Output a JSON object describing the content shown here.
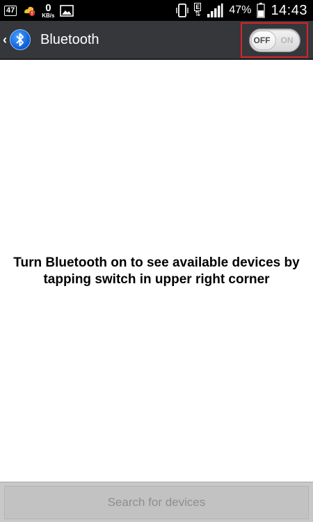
{
  "status_bar": {
    "badge": "47",
    "speed_value": "0",
    "speed_unit": "KB/s",
    "network_type": "E",
    "network_arrows": "⇅",
    "battery_percent": "47%",
    "time": "14:43",
    "icons": [
      "notification-badge-icon",
      "weather-alert-icon",
      "image-icon",
      "vibrate-icon",
      "network-type-icon",
      "signal-icon",
      "battery-icon"
    ]
  },
  "action_bar": {
    "back_glyph": "‹",
    "title": "Bluetooth",
    "toggle": {
      "off_label": "OFF",
      "on_label": "ON",
      "state": "off"
    },
    "highlight_color": "#d8232a"
  },
  "main": {
    "message": "Turn Bluetooth on to see available devices by tapping switch in upper right corner"
  },
  "bottom": {
    "search_label": "Search for devices",
    "enabled": false
  }
}
